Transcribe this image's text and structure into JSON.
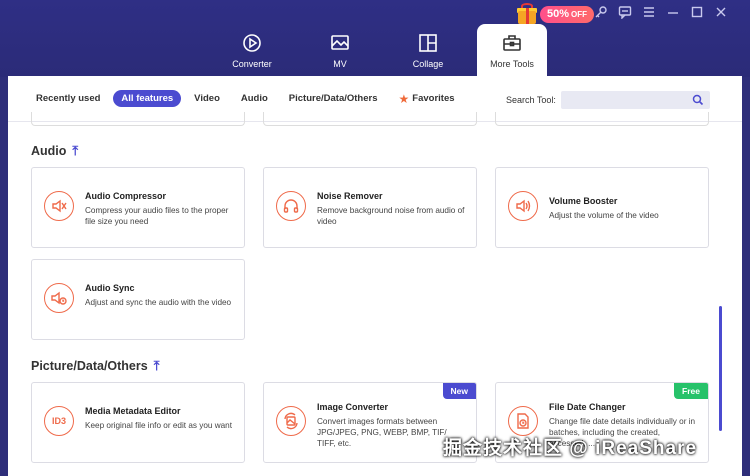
{
  "promo": {
    "percent": "50%",
    "off": "OFF"
  },
  "tabs": [
    {
      "label": "Converter"
    },
    {
      "label": "MV"
    },
    {
      "label": "Collage"
    },
    {
      "label": "More Tools"
    }
  ],
  "filters": {
    "recently_used": "Recently used",
    "all_features": "All features",
    "video": "Video",
    "audio": "Audio",
    "picture": "Picture/Data/Others",
    "favorites": "Favorites"
  },
  "search": {
    "label": "Search Tool:",
    "placeholder": ""
  },
  "sections": {
    "audio": {
      "title": "Audio"
    },
    "picture": {
      "title": "Picture/Data/Others"
    }
  },
  "cards": {
    "audio_compressor": {
      "title": "Audio Compressor",
      "desc": "Compress your audio files to the proper file size you need"
    },
    "noise_remover": {
      "title": "Noise Remover",
      "desc": "Remove background noise from audio of video"
    },
    "volume_booster": {
      "title": "Volume Booster",
      "desc": "Adjust the volume of the video"
    },
    "audio_sync": {
      "title": "Audio Sync",
      "desc": "Adjust and sync the audio with the video"
    },
    "metadata_editor": {
      "title": "Media Metadata Editor",
      "desc": "Keep original file info or edit as you want",
      "icon_text": "ID3"
    },
    "image_converter": {
      "title": "Image Converter",
      "desc": "Convert images formats between JPG/JPEG, PNG, WEBP, BMP, TIF/ TIFF, etc.",
      "tag": "New"
    },
    "file_date_changer": {
      "title": "File Date Changer",
      "desc": "Change file date details individually or in batches, including the created, accessed, ...",
      "tag": "Free"
    }
  },
  "watermark": "掘金技术社区 @ iReaShare",
  "colors": {
    "accent": "#4b4bd0",
    "icon_orange": "#ef6a4a",
    "header_bg": "#2e2e7a",
    "free_green": "#27c26a"
  }
}
